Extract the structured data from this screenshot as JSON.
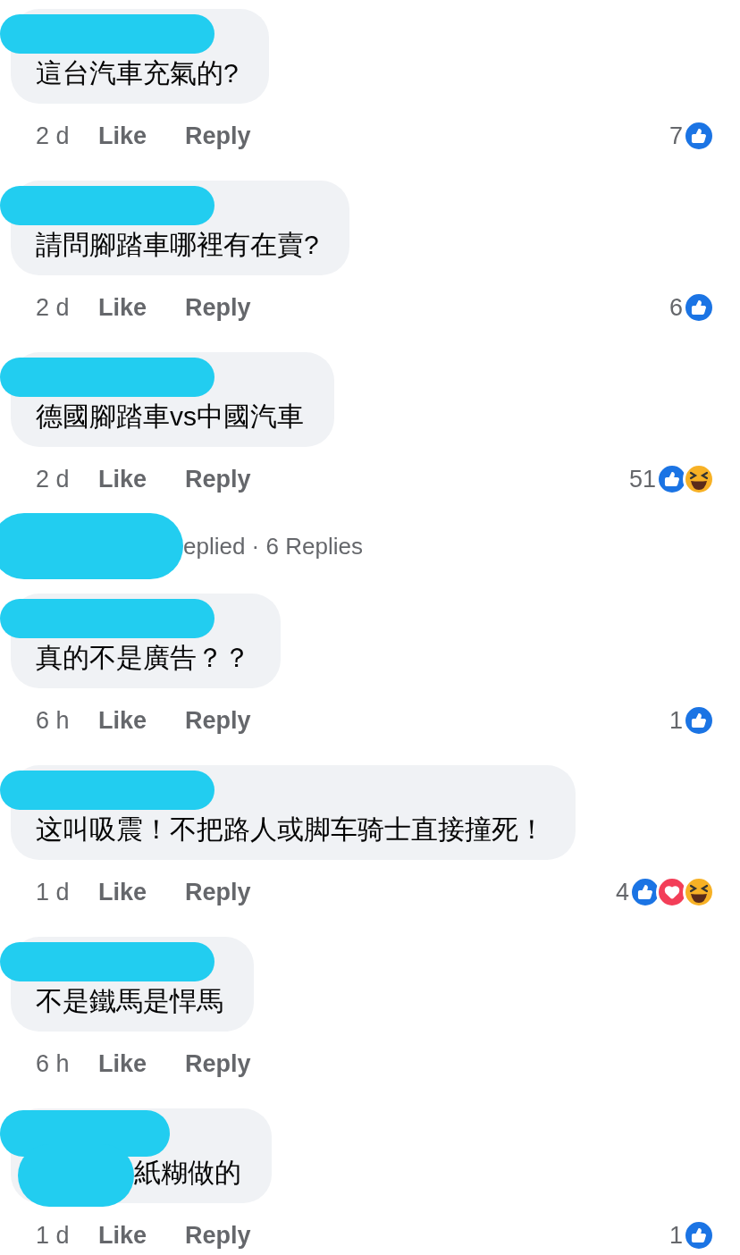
{
  "items": [
    {
      "kind": "comment",
      "text": "這台汽車充氣的?",
      "time": "2 d",
      "like": "Like",
      "reply": "Reply",
      "count": "7",
      "reactions": [
        {
          "kind": "like"
        }
      ]
    },
    {
      "kind": "comment",
      "text": "請問腳踏車哪裡有在賣?",
      "time": "2 d",
      "like": "Like",
      "reply": "Reply",
      "count": "6",
      "reactions": [
        {
          "kind": "like"
        }
      ]
    },
    {
      "kind": "comment",
      "text": "德國腳踏車vs中國汽車",
      "time": "2 d",
      "like": "Like",
      "reply": "Reply",
      "count": "51",
      "reactions": [
        {
          "kind": "like"
        },
        {
          "kind": "haha"
        }
      ]
    },
    {
      "kind": "replies",
      "text": "eplied · 6 Replies"
    },
    {
      "kind": "comment",
      "text": "真的不是廣告？？",
      "time": "6 h",
      "like": "Like",
      "reply": "Reply",
      "count": "1",
      "reactions": [
        {
          "kind": "like"
        }
      ]
    },
    {
      "kind": "comment",
      "text": "这叫吸震！不把路人或脚车骑士直接撞死！",
      "time": "1 d",
      "like": "Like",
      "reply": "Reply",
      "count": "4",
      "reactions": [
        {
          "kind": "like"
        },
        {
          "kind": "love"
        },
        {
          "kind": "haha"
        }
      ]
    },
    {
      "kind": "comment",
      "text": "不是鐵馬是悍馬",
      "time": "6 h",
      "like": "Like",
      "reply": "Reply"
    },
    {
      "kind": "comment_text_hidden",
      "text": "紙糊做的",
      "time": "1 d",
      "like": "Like",
      "reply": "Reply",
      "count": "1",
      "reactions": [
        {
          "kind": "like"
        }
      ]
    }
  ]
}
